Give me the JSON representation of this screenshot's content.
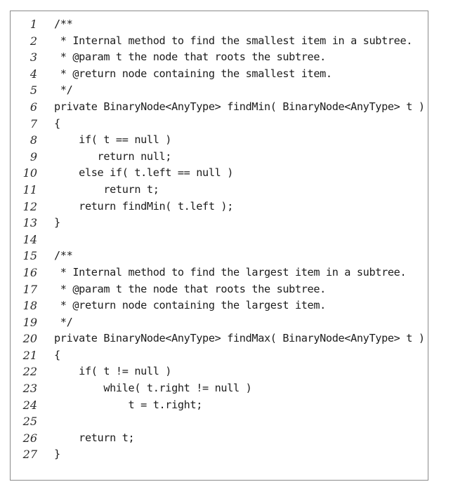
{
  "code_listing": {
    "lines": [
      {
        "number": "1",
        "text": "/**"
      },
      {
        "number": "2",
        "text": " * Internal method to find the smallest item in a subtree."
      },
      {
        "number": "3",
        "text": " * @param t the node that roots the subtree."
      },
      {
        "number": "4",
        "text": " * @return node containing the smallest item."
      },
      {
        "number": "5",
        "text": " */"
      },
      {
        "number": "6",
        "text": "private BinaryNode<AnyType> findMin( BinaryNode<AnyType> t )"
      },
      {
        "number": "7",
        "text": "{"
      },
      {
        "number": "8",
        "text": "    if( t == null )"
      },
      {
        "number": "9",
        "text": "       return null;"
      },
      {
        "number": "10",
        "text": "    else if( t.left == null )"
      },
      {
        "number": "11",
        "text": "        return t;"
      },
      {
        "number": "12",
        "text": "    return findMin( t.left );"
      },
      {
        "number": "13",
        "text": "}"
      },
      {
        "number": "14",
        "text": ""
      },
      {
        "number": "15",
        "text": "/**"
      },
      {
        "number": "16",
        "text": " * Internal method to find the largest item in a subtree."
      },
      {
        "number": "17",
        "text": " * @param t the node that roots the subtree."
      },
      {
        "number": "18",
        "text": " * @return node containing the largest item."
      },
      {
        "number": "19",
        "text": " */"
      },
      {
        "number": "20",
        "text": "private BinaryNode<AnyType> findMax( BinaryNode<AnyType> t )"
      },
      {
        "number": "21",
        "text": "{"
      },
      {
        "number": "22",
        "text": "    if( t != null )"
      },
      {
        "number": "23",
        "text": "        while( t.right != null )"
      },
      {
        "number": "24",
        "text": "            t = t.right;"
      },
      {
        "number": "25",
        "text": ""
      },
      {
        "number": "26",
        "text": "    return t;"
      },
      {
        "number": "27",
        "text": "}"
      }
    ]
  }
}
